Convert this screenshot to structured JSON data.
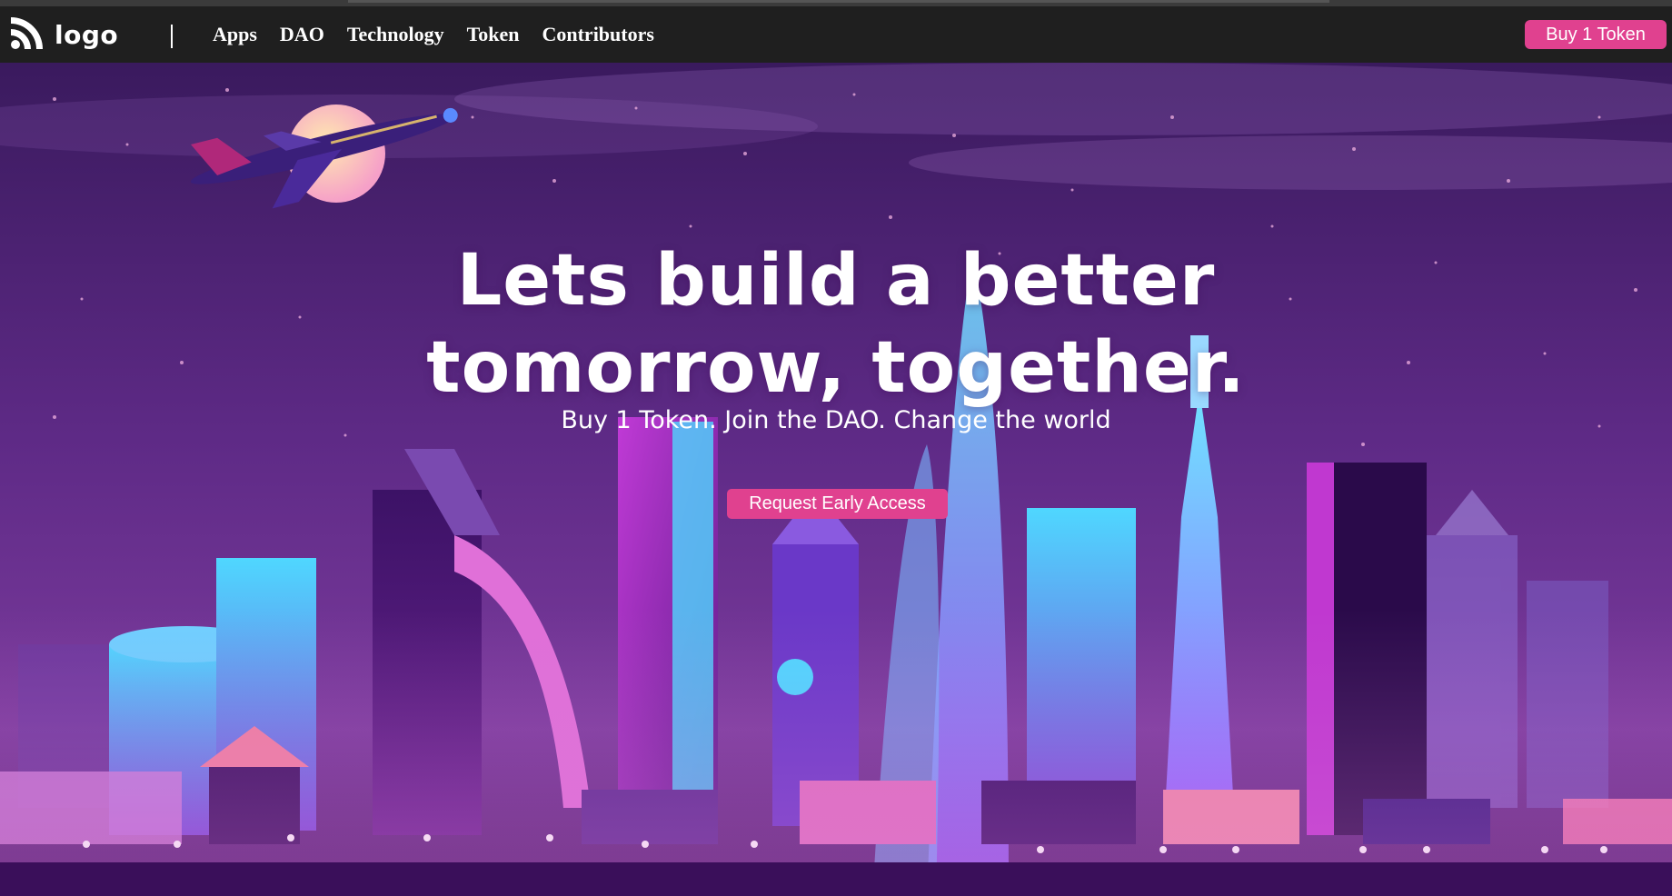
{
  "navbar": {
    "logo_text": "logo",
    "links": [
      {
        "label": "Apps"
      },
      {
        "label": "DAO"
      },
      {
        "label": "Technology"
      },
      {
        "label": "Token"
      },
      {
        "label": "Contributors"
      }
    ],
    "cta_label": "Buy 1 Token"
  },
  "hero": {
    "title_line1": "Lets build a better",
    "title_line2": "tomorrow, together.",
    "subtitle": "Buy 1 Token. Join the DAO. Change the world",
    "cta_label": "Request Early Access"
  },
  "colors": {
    "accent": "#e0418f",
    "navbar_bg": "#1f1f1f",
    "sky_top": "#3a1a5e",
    "sky_mid": "#6b2f8f"
  },
  "icons": {
    "logo": "rss-icon"
  }
}
